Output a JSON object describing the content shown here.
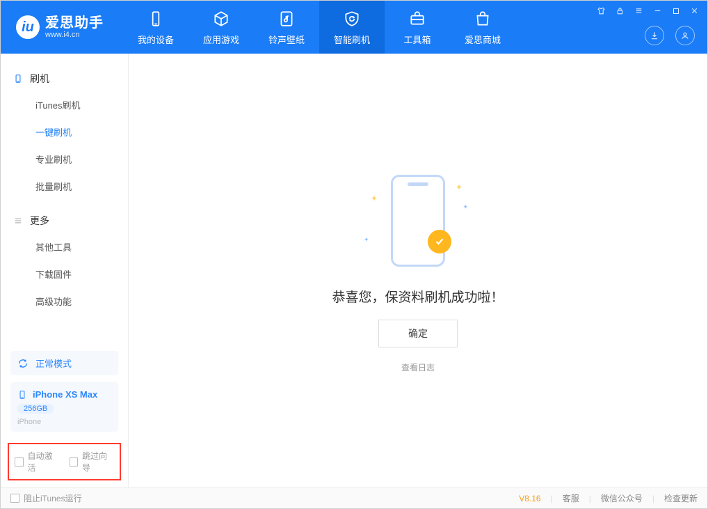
{
  "app": {
    "name": "爱思助手",
    "domain": "www.i4.cn"
  },
  "nav": {
    "items": [
      {
        "label": "我的设备"
      },
      {
        "label": "应用游戏"
      },
      {
        "label": "铃声壁纸"
      },
      {
        "label": "智能刷机"
      },
      {
        "label": "工具箱"
      },
      {
        "label": "爱思商城"
      }
    ]
  },
  "sidebar": {
    "section_flash": "刷机",
    "items_flash": [
      {
        "label": "iTunes刷机"
      },
      {
        "label": "一键刷机",
        "active": true
      },
      {
        "label": "专业刷机"
      },
      {
        "label": "批量刷机"
      }
    ],
    "section_more": "更多",
    "items_more": [
      {
        "label": "其他工具"
      },
      {
        "label": "下载固件"
      },
      {
        "label": "高级功能"
      }
    ],
    "mode_label": "正常模式",
    "device_name": "iPhone XS Max",
    "device_storage": "256GB",
    "device_type": "iPhone",
    "checkbox_auto_activate": "自动激活",
    "checkbox_skip_wizard": "跳过向导"
  },
  "main": {
    "success_text": "恭喜您，保资料刷机成功啦！",
    "ok_button": "确定",
    "view_log": "查看日志"
  },
  "statusbar": {
    "block_itunes": "阻止iTunes运行",
    "version": "V8.16",
    "support": "客服",
    "wechat": "微信公众号",
    "check_update": "检查更新"
  }
}
